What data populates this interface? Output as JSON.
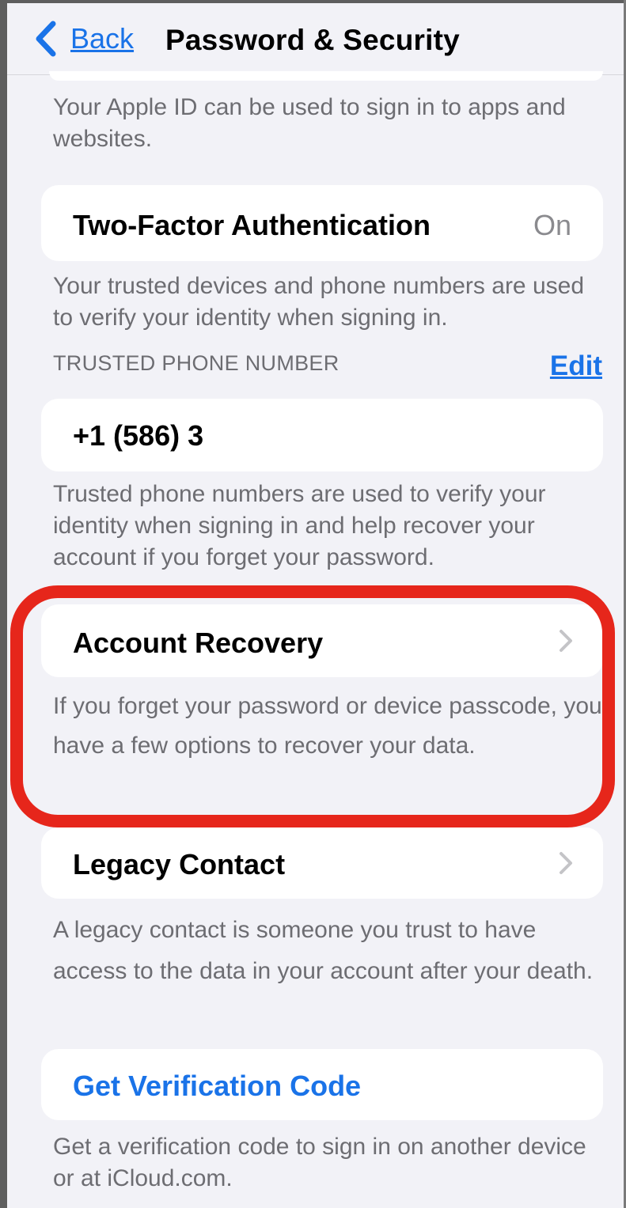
{
  "navbar": {
    "back_label": "Back",
    "title": "Password & Security"
  },
  "apple_id_footer": "Your Apple ID can be used to sign in to apps and websites.",
  "two_factor": {
    "label": "Two-Factor Authentication",
    "value": "On",
    "footer": "Your trusted devices and phone numbers are used to verify your identity when signing in."
  },
  "trusted_phone": {
    "header": "TRUSTED PHONE NUMBER",
    "edit_label": "Edit",
    "number": "+1 (586) 3",
    "footer": "Trusted phone numbers are used to verify your identity when signing in and help recover your account if you forget your password."
  },
  "account_recovery": {
    "label": "Account Recovery",
    "footer": "If you forget your password or device passcode, you have a few options to recover your data."
  },
  "legacy_contact": {
    "label": "Legacy Contact",
    "footer": "A legacy contact is someone you trust to have access to the data in your account after your death."
  },
  "verification": {
    "label": "Get Verification Code",
    "footer": "Get a verification code to sign in on another device or at iCloud.com."
  },
  "colors": {
    "accent": "#1a73e8",
    "background": "#f2f2f7",
    "highlight": "#e6261b",
    "secondary_text": "#6d6d72"
  },
  "icons": [
    "chevron-left-icon",
    "chevron-right-icon"
  ]
}
